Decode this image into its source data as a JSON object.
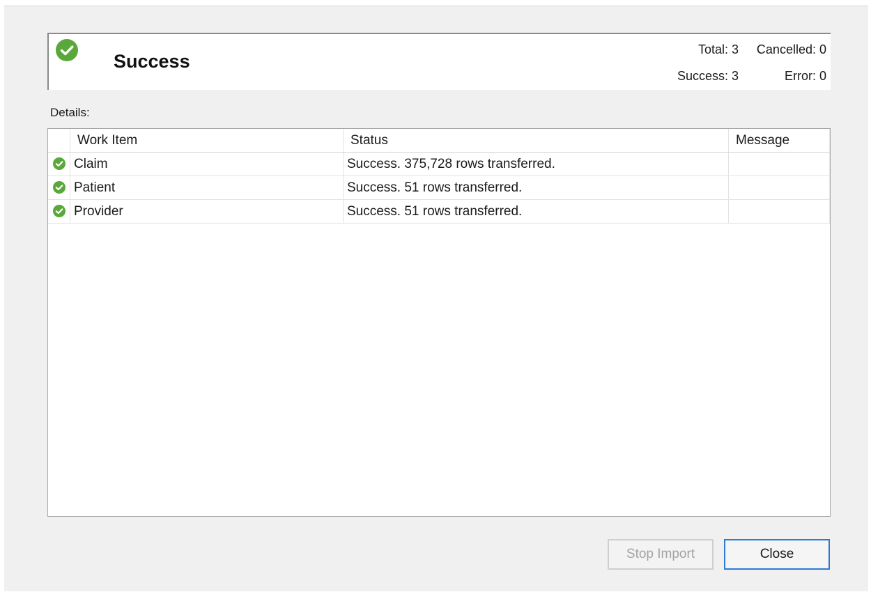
{
  "header": {
    "title": "Success",
    "icon": "check-circle-icon",
    "icon_color": "#5aa83a",
    "stats": {
      "total": "Total: 3",
      "cancelled": "Cancelled: 0",
      "success": "Success: 3",
      "error": "Error: 0"
    }
  },
  "details": {
    "label": "Details:",
    "columns": {
      "work_item": "Work Item",
      "status": "Status",
      "message": "Message"
    },
    "rows": [
      {
        "icon": "check-circle-icon",
        "work_item": "Claim",
        "status": "Success. 375,728 rows transferred.",
        "message": ""
      },
      {
        "icon": "check-circle-icon",
        "work_item": "Patient",
        "status": "Success. 51 rows transferred.",
        "message": ""
      },
      {
        "icon": "check-circle-icon",
        "work_item": "Provider",
        "status": "Success. 51 rows transferred.",
        "message": ""
      }
    ]
  },
  "buttons": {
    "stop_import": "Stop Import",
    "close": "Close"
  },
  "colors": {
    "accent": "#2d7bd4",
    "success": "#5aa83a"
  }
}
